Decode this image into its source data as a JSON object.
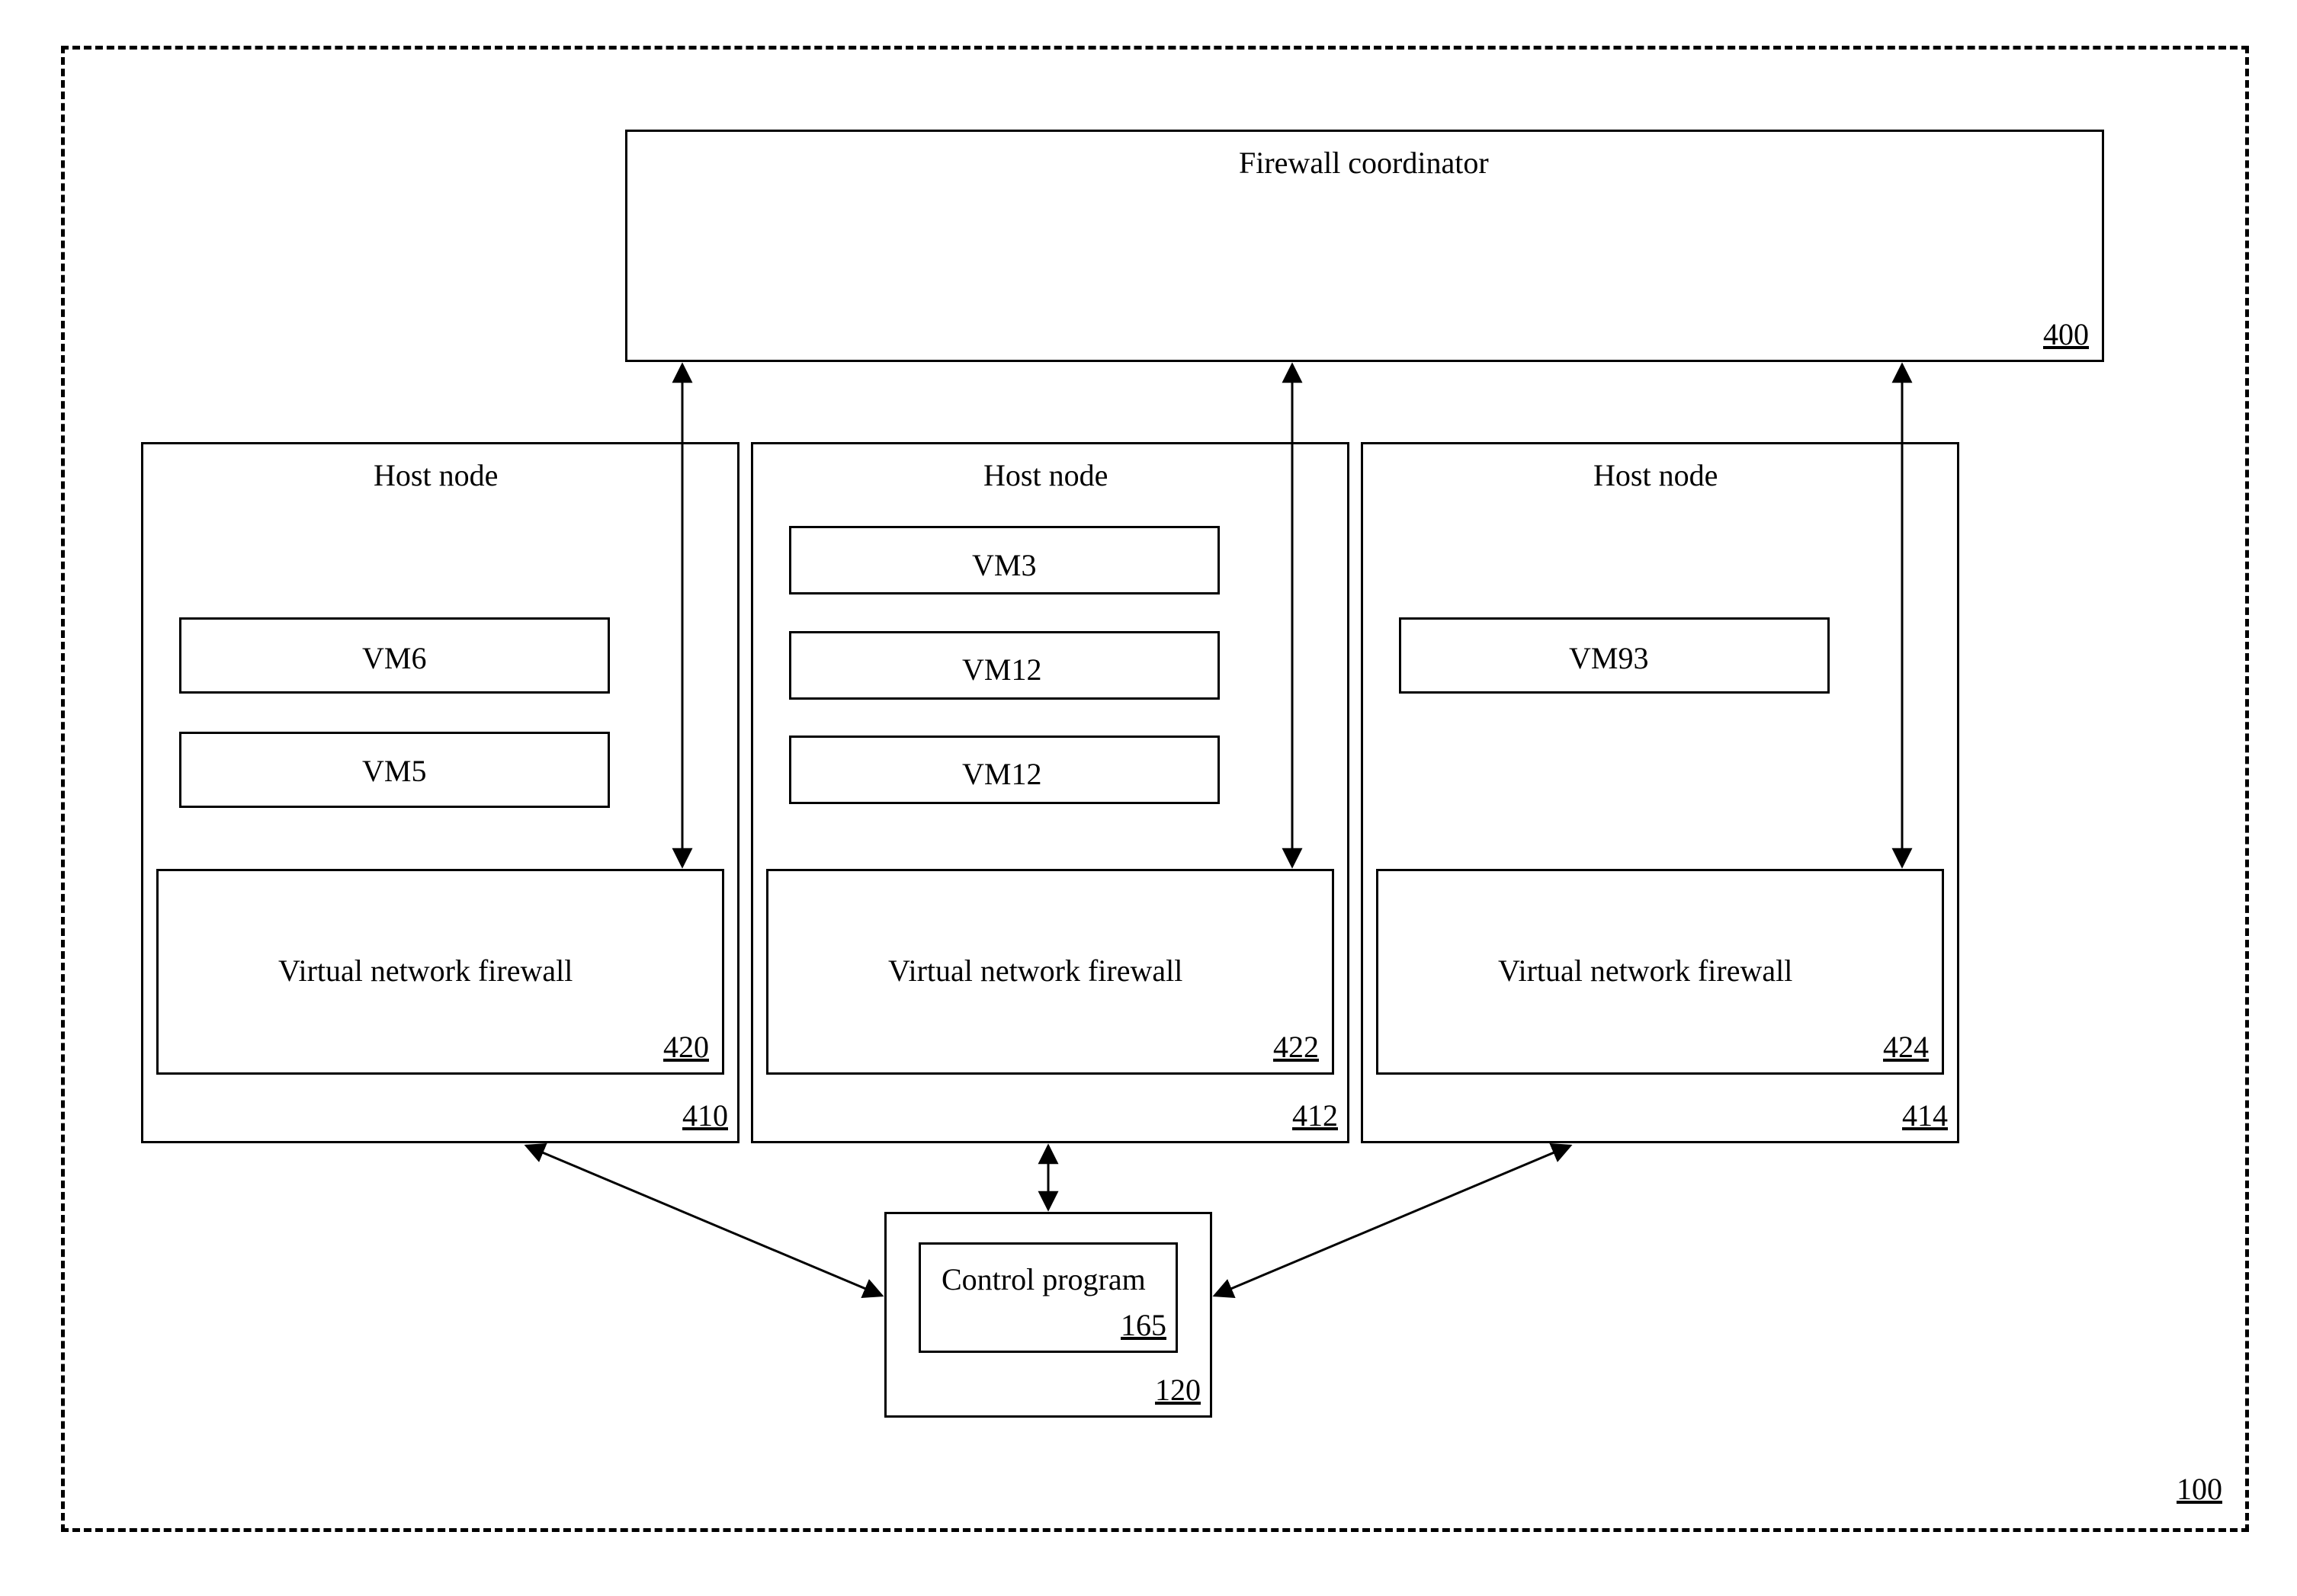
{
  "outer": {
    "ref": "100"
  },
  "coordinator": {
    "label": "Firewall coordinator",
    "ref": "400"
  },
  "hosts": [
    {
      "label": "Host node",
      "ref": "410",
      "vms": [
        "VM6",
        "VM5"
      ],
      "firewall": {
        "label": "Virtual network firewall",
        "ref": "420"
      }
    },
    {
      "label": "Host node",
      "ref": "412",
      "vms": [
        "VM3",
        "VM12",
        "VM12"
      ],
      "firewall": {
        "label": "Virtual network firewall",
        "ref": "422"
      }
    },
    {
      "label": "Host node",
      "ref": "414",
      "vms": [
        "VM93"
      ],
      "firewall": {
        "label": "Virtual network firewall",
        "ref": "424"
      }
    }
  ],
  "control": {
    "outer_ref": "120",
    "inner_label": "Control program",
    "inner_ref": "165"
  }
}
